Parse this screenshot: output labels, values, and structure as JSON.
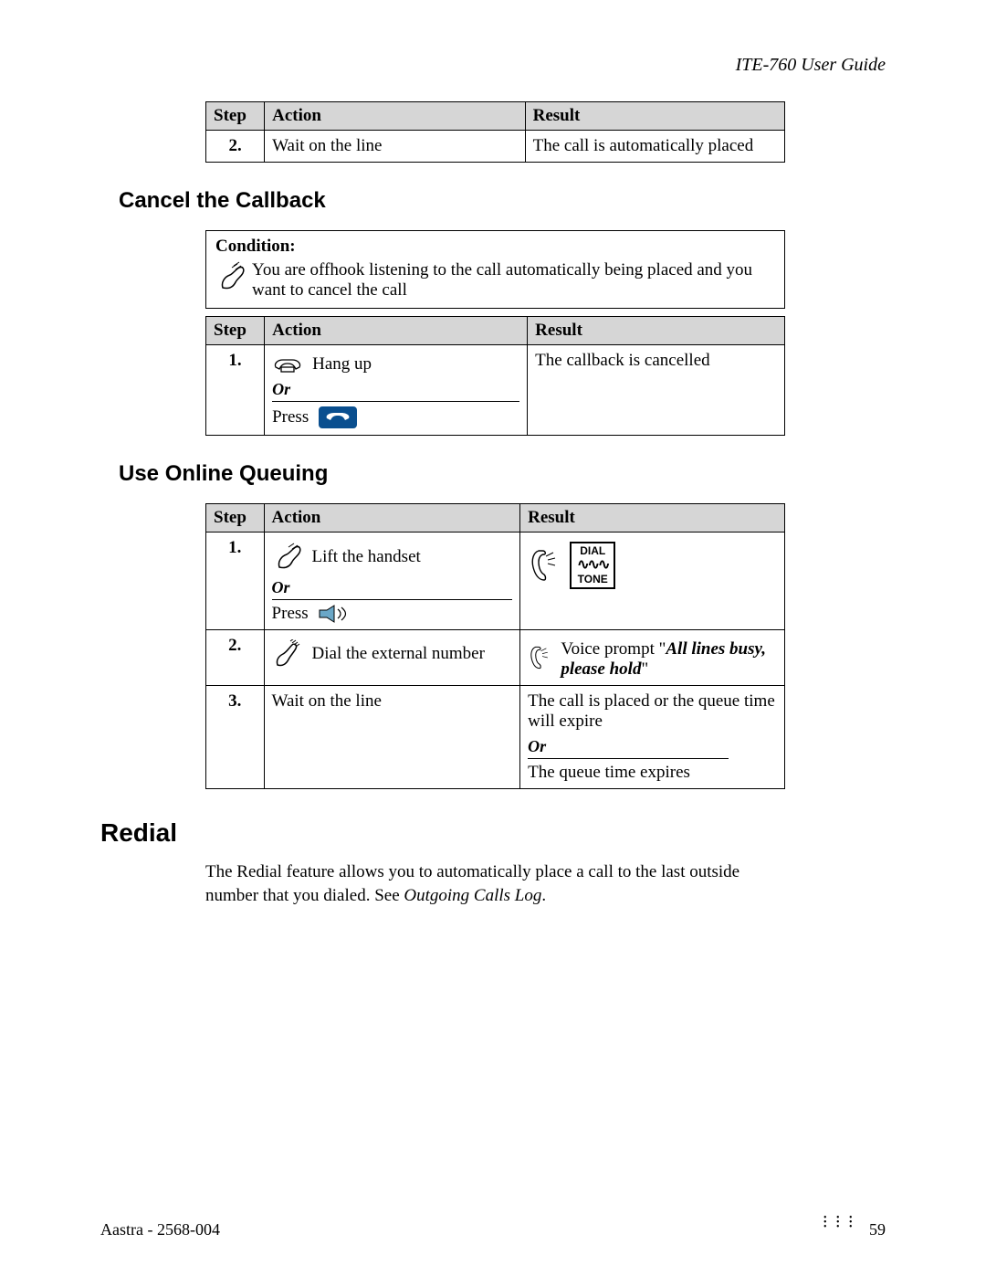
{
  "header": {
    "doc_title": "ITE-760 User Guide"
  },
  "table_top": {
    "headers": {
      "step": "Step",
      "action": "Action",
      "result": "Result"
    },
    "rows": [
      {
        "step": "2.",
        "action": "Wait on the line",
        "result": "The call is automatically placed"
      }
    ]
  },
  "section_cancel": {
    "title": "Cancel the Callback",
    "condition_label": "Condition:",
    "condition_text": "You are offhook listening to the call automatically being placed and you want to cancel the call",
    "table": {
      "headers": {
        "step": "Step",
        "action": "Action",
        "result": "Result"
      },
      "rows": [
        {
          "step": "1.",
          "action_hangup": "Hang up",
          "or": "Or",
          "press": "Press",
          "result": "The callback is cancelled"
        }
      ]
    }
  },
  "section_queue": {
    "title": "Use Online Queuing",
    "table": {
      "headers": {
        "step": "Step",
        "action": "Action",
        "result": "Result"
      },
      "rows": [
        {
          "step": "1.",
          "lift": "Lift the handset",
          "or": "Or",
          "press": "Press",
          "dialtone_top": "DIAL",
          "dialtone_bot": "TONE"
        },
        {
          "step": "2.",
          "dial": "Dial the external number",
          "voice_pre": "Voice prompt \"",
          "voice_em": "All lines busy, please hold",
          "voice_post": "\""
        },
        {
          "step": "3.",
          "wait": "Wait on the line",
          "result1": "The call is placed or the queue time will expire",
          "or": "Or",
          "result2": "The queue time expires"
        }
      ]
    }
  },
  "section_redial": {
    "title": "Redial",
    "body_pre": "The Redial feature allows you to automatically place a call to the last outside number that you dialed.  See ",
    "body_em": "Outgoing Calls Log",
    "body_post": "."
  },
  "footer": {
    "left": "Aastra - 2568-004",
    "page": "59"
  }
}
